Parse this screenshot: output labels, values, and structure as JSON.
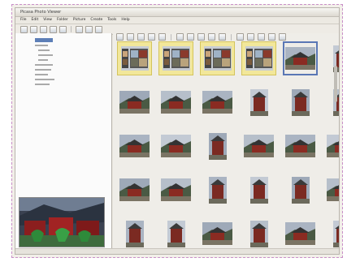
{
  "window": {
    "title": "Picasa Photo Viewer"
  },
  "menu": [
    "File",
    "Edit",
    "View",
    "Folder",
    "Picture",
    "Create",
    "Tools",
    "Help"
  ],
  "toolbar": {
    "buttons": [
      "back-icon",
      "forward-icon",
      "refresh-icon",
      "zoom-in-icon",
      "zoom-out-icon",
      "grid-icon",
      "view-icon",
      "home-icon"
    ]
  },
  "thumb_toolbar": {
    "buttons": [
      "back-icon",
      "rotate-left-icon",
      "rotate-right-icon",
      "star-icon",
      "crop-icon",
      "tag-icon",
      "print-icon",
      "email-icon",
      "upload-icon",
      "share-icon",
      "slideshow-icon",
      "settings-icon",
      "help-icon",
      "delete-icon",
      "info-icon"
    ]
  },
  "thumbnails": {
    "rows": [
      [
        {
          "type": "folder",
          "shape": "wide"
        },
        {
          "type": "folder",
          "shape": "wide"
        },
        {
          "type": "folder",
          "shape": "wide"
        },
        {
          "type": "folder",
          "shape": "wide"
        },
        {
          "type": "photo",
          "shape": "wide",
          "selected": true
        },
        {
          "type": "photo",
          "shape": "tall"
        }
      ],
      [
        {
          "type": "photo",
          "shape": "wide"
        },
        {
          "type": "photo",
          "shape": "wide"
        },
        {
          "type": "photo",
          "shape": "wide"
        },
        {
          "type": "photo",
          "shape": "tall"
        },
        {
          "type": "photo",
          "shape": "tall"
        },
        {
          "type": "photo",
          "shape": "tall"
        }
      ],
      [
        {
          "type": "photo",
          "shape": "wide"
        },
        {
          "type": "photo",
          "shape": "wide"
        },
        {
          "type": "photo",
          "shape": "tall"
        },
        {
          "type": "photo",
          "shape": "wide"
        },
        {
          "type": "photo",
          "shape": "wide"
        },
        {
          "type": "photo",
          "shape": "wide"
        }
      ],
      [
        {
          "type": "photo",
          "shape": "wide"
        },
        {
          "type": "photo",
          "shape": "wide"
        },
        {
          "type": "photo",
          "shape": "tall"
        },
        {
          "type": "photo",
          "shape": "tall"
        },
        {
          "type": "photo",
          "shape": "tall"
        },
        {
          "type": "photo",
          "shape": "wide"
        }
      ],
      [
        {
          "type": "photo",
          "shape": "tall"
        },
        {
          "type": "photo",
          "shape": "tall"
        },
        {
          "type": "photo",
          "shape": "wide"
        },
        {
          "type": "photo",
          "shape": "tall"
        },
        {
          "type": "photo",
          "shape": "wide"
        },
        {
          "type": "photo",
          "shape": "tall"
        }
      ]
    ]
  },
  "colors": {
    "accent": "#5d7fb7",
    "folder_bg": "#f2e79a",
    "frame_border": "#c98fc9"
  }
}
